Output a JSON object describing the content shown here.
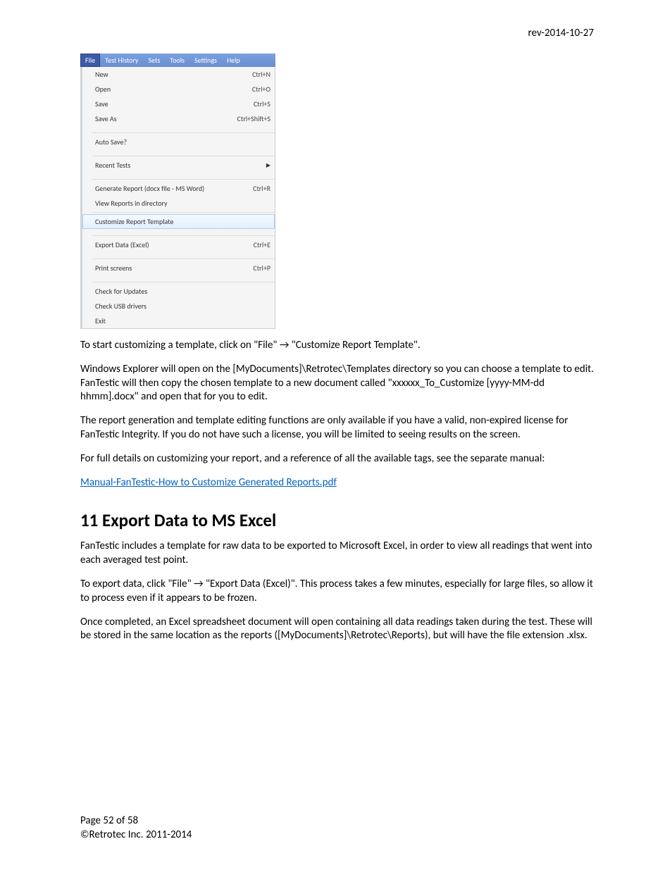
{
  "header": {
    "revision": "rev-2014-10-27"
  },
  "menubar": {
    "items": [
      {
        "label": "File",
        "active": true
      },
      {
        "label": "Test History"
      },
      {
        "label": "Sets"
      },
      {
        "label": "Tools"
      },
      {
        "label": "Settings"
      },
      {
        "label": "Help"
      }
    ]
  },
  "dropdown_groups": [
    [
      {
        "label": "New",
        "shortcut": "Ctrl+N"
      },
      {
        "label": "Open",
        "shortcut": "Ctrl+O"
      },
      {
        "label": "Save",
        "shortcut": "Ctrl+S"
      },
      {
        "label": "Save As",
        "shortcut": "Ctrl+Shift+S"
      }
    ],
    [
      {
        "label": "Auto Save?"
      }
    ],
    [
      {
        "label": "Recent Tests",
        "submenu": true
      }
    ],
    [
      {
        "label": "Generate Report (docx file - MS Word)",
        "shortcut": "Ctrl+R"
      },
      {
        "label": "View Reports in directory"
      }
    ],
    [
      {
        "label": "Customize Report Template",
        "highlight": true
      }
    ],
    [
      {
        "label": "Export Data (Excel)",
        "shortcut": "Ctrl+E"
      }
    ],
    [
      {
        "label": "Print screens",
        "shortcut": "Ctrl+P"
      }
    ],
    [
      {
        "label": "Check for Updates"
      },
      {
        "label": "Check USB drivers"
      },
      {
        "label": "Exit"
      }
    ]
  ],
  "paragraphs": {
    "p1": "To start customizing a template, click on \"File\" → \"Customize Report Template\".",
    "p2": "Windows Explorer will open on the [MyDocuments]\\Retrotec\\Templates  directory so you can choose a template to edit.  FanTestic will then copy the chosen template to a new document called \"xxxxxx_To_Customize [yyyy-MM-dd hhmm].docx\" and open that for you to edit.",
    "p3": "The report generation and template editing functions are only available if you have a valid, non-expired license for FanTestic Integrity.  If you do not have such a license, you will be limited to seeing results on the screen.",
    "p4": "For full details on customizing your report, and a reference of all the available tags, see  the separate manual:",
    "link": "Manual-FanTestic-How to Customize Generated Reports.pdf",
    "h2": "11 Export Data to MS Excel",
    "p5": "FanTestic includes a template for raw data to be exported to Microsoft Excel, in order to view all readings that went into each averaged test point.",
    "p6": "To export data, click \"File\" → \"Export Data (Excel)\".  This process takes a few minutes, especially for large files, so allow it to process even if it appears to be frozen.",
    "p7": "Once completed, an Excel spreadsheet document will open containing all data readings taken during the test.  These will be stored in the same location as the reports ([MyDocuments]\\Retrotec\\Reports), but will have the file extension .xlsx."
  },
  "footer": {
    "page": "Page 52 of 58",
    "copyright": "©Retrotec Inc. 2011-2014"
  }
}
